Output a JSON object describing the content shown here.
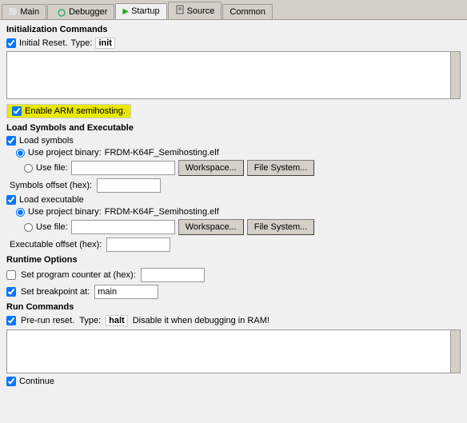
{
  "tabs": [
    {
      "id": "main",
      "label": "Main",
      "active": false,
      "icon": "⬛"
    },
    {
      "id": "debugger",
      "label": "Debugger",
      "active": false,
      "icon": "🐛"
    },
    {
      "id": "startup",
      "label": "Startup",
      "active": true,
      "icon": "▶"
    },
    {
      "id": "source",
      "label": "Source",
      "active": false,
      "icon": "📄"
    },
    {
      "id": "common",
      "label": "Common",
      "active": false,
      "icon": ""
    }
  ],
  "sections": {
    "init_commands": {
      "title": "Initialization Commands",
      "initial_reset": {
        "checked": true,
        "label": "Initial Reset.",
        "type_label": "Type:",
        "type_value": "init"
      },
      "text_area": ""
    },
    "enable_arm": {
      "checked": true,
      "label": "Enable ARM semihosting."
    },
    "load_symbols": {
      "title": "Load Symbols and Executable",
      "load_symbols_checked": true,
      "load_symbols_label": "Load symbols",
      "use_project_binary_radio": true,
      "use_project_binary_label": "Use project binary:",
      "use_project_binary_value": "FRDM-K64F_Semihosting.elf",
      "use_file_label": "Use file:",
      "use_file_value": "",
      "workspace_btn": "Workspace...",
      "filesystem_btn": "File System...",
      "symbols_offset_label": "Symbols offset (hex):",
      "symbols_offset_value": "",
      "load_executable_checked": true,
      "load_executable_label": "Load executable",
      "use_project_binary2_radio": true,
      "use_project_binary2_label": "Use project binary:",
      "use_project_binary2_value": "FRDM-K64F_Semihosting.elf",
      "use_file2_label": "Use file:",
      "use_file2_value": "",
      "workspace2_btn": "Workspace...",
      "filesystem2_btn": "File System...",
      "executable_offset_label": "Executable offset (hex):",
      "executable_offset_value": ""
    },
    "runtime_options": {
      "title": "Runtime Options",
      "set_pc_checked": false,
      "set_pc_label": "Set program counter at (hex):",
      "set_pc_value": "",
      "set_breakpoint_checked": true,
      "set_breakpoint_label": "Set breakpoint at:",
      "set_breakpoint_value": "main"
    },
    "run_commands": {
      "title": "Run Commands",
      "pre_run_reset_checked": true,
      "pre_run_reset_label": "Pre-run reset.",
      "type_label": "Type:",
      "type_value": "halt",
      "disable_label": "Disable it when debugging in RAM!",
      "text_area": ""
    },
    "continue": {
      "checked": true,
      "label": "Continue"
    }
  }
}
